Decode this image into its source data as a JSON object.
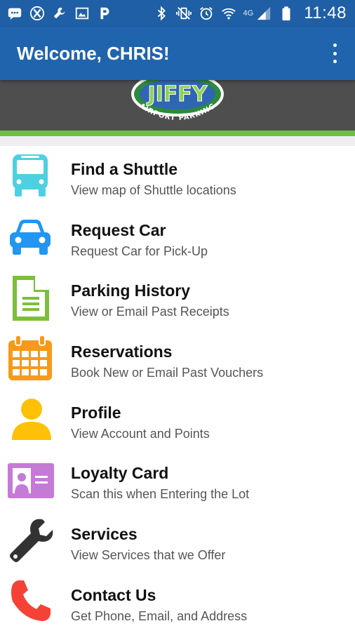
{
  "status_bar": {
    "time": "11:48",
    "network_label": "4G",
    "left_icons": [
      "messages-icon",
      "xbox-icon",
      "wrench-icon",
      "image-icon",
      "parking-p-icon"
    ],
    "right_icons": [
      "bluetooth-icon",
      "vibrate-icon",
      "alarm-icon",
      "wifi-icon",
      "signal-icon",
      "battery-icon"
    ]
  },
  "app_bar": {
    "title": "Welcome, CHRIS!",
    "overflow_icon": "more-vert-icon"
  },
  "banner": {
    "logo_text": "JIFFY",
    "logo_subtext": "AIRPORT PARKING"
  },
  "menu": [
    {
      "title": "Find a Shuttle",
      "subtitle": "View map of Shuttle locations",
      "icon": "bus-icon",
      "color": "#4dd0e1"
    },
    {
      "title": "Request Car",
      "subtitle": "Request Car for Pick-Up",
      "icon": "car-icon",
      "color": "#2196f3"
    },
    {
      "title": "Parking History",
      "subtitle": "View or Email Past Receipts",
      "icon": "document-icon",
      "color": "#7cbf3a"
    },
    {
      "title": "Reservations",
      "subtitle": "Book New or Email Past Vouchers",
      "icon": "calendar-icon",
      "color": "#f59a1b"
    },
    {
      "title": "Profile",
      "subtitle": "View Account and Points",
      "icon": "person-icon",
      "color": "#ffc107"
    },
    {
      "title": "Loyalty Card",
      "subtitle": "Scan this when Entering the Lot",
      "icon": "id-card-icon",
      "color": "#c57ad6"
    },
    {
      "title": "Services",
      "subtitle": "View Services that we Offer",
      "icon": "wrench-icon",
      "color": "#333333"
    },
    {
      "title": "Contact Us",
      "subtitle": "Get Phone, Email, and Address",
      "icon": "phone-icon",
      "color": "#f44336"
    }
  ],
  "colors": {
    "status_bar": "#1f5fa6",
    "app_bar": "#2064ad",
    "banner": "#4e4e4e",
    "accent_line": "#6cbf44"
  }
}
